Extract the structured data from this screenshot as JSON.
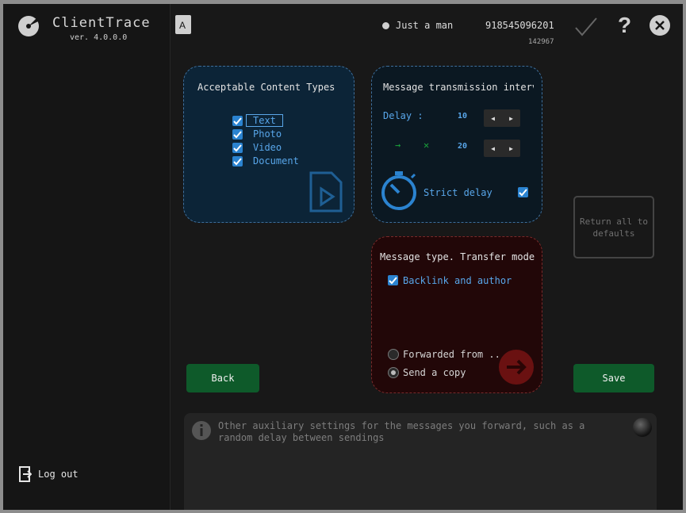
{
  "app": {
    "name": "ClientTrace",
    "version": "ver. 4.0.0.0"
  },
  "user": {
    "name": "Just a man",
    "phone": "918545096201",
    "id": "142967"
  },
  "sidebar": {
    "logout_label": "Log out"
  },
  "content_types": {
    "title": "Acceptable Content Types",
    "items": [
      {
        "label": "Text",
        "checked": true
      },
      {
        "label": "Photo",
        "checked": true
      },
      {
        "label": "Video",
        "checked": true
      },
      {
        "label": "Document",
        "checked": true
      }
    ]
  },
  "transmission": {
    "title": "Message transmission interv",
    "delay_label": "Delay :",
    "delay_value": "10",
    "arrow_glyph": "→",
    "cross_glyph": "✕",
    "random_value": "20",
    "strict_label": "Strict delay",
    "strict_checked": true
  },
  "defaults_button": {
    "label": "Return all to defaults"
  },
  "transfer": {
    "title": "Message type. Transfer mode",
    "backlink_label": "Backlink and author",
    "backlink_checked": true,
    "options": [
      {
        "label": "Forwarded from ..",
        "selected": false
      },
      {
        "label": "Send a copy",
        "selected": true
      }
    ]
  },
  "buttons": {
    "back": "Back",
    "save": "Save"
  },
  "info": {
    "text": "Other auxiliary settings for the messages you forward, such as a random delay between sendings"
  },
  "colors": {
    "accent_blue": "#2b83d0",
    "save_green": "#0e5a2a",
    "transfer_red": "#220708"
  }
}
